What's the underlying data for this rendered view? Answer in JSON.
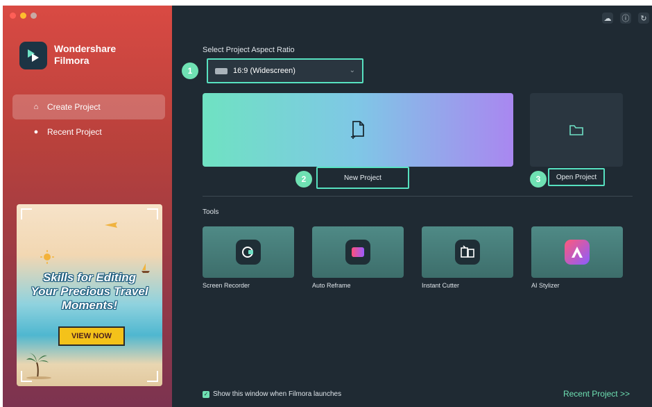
{
  "app": {
    "name": "Wondershare Filmora"
  },
  "sidebar": {
    "brand_line1": "Wondershare",
    "brand_line2": "Filmora",
    "items": [
      {
        "label": "Create Project",
        "icon": "home-icon",
        "active": true
      },
      {
        "label": "Recent Project",
        "icon": "clock-icon",
        "active": false
      }
    ],
    "banner": {
      "headline1": "Skills for Editing",
      "headline2": "Your Precious Travel",
      "headline3": "Moments!",
      "button_label": "VIEW NOW"
    }
  },
  "topbar": {
    "icons": [
      "cloud-icon",
      "info-icon",
      "refresh-icon"
    ]
  },
  "main": {
    "aspect_label": "Select Project Aspect Ratio",
    "aspect_value": "16:9 (Widescreen)",
    "steps": [
      "1",
      "2",
      "3"
    ],
    "new_project_label": "New Project",
    "open_project_label": "Open Project",
    "tools_label": "Tools",
    "tools": [
      {
        "label": "Screen Recorder",
        "icon": "screen-recorder-icon"
      },
      {
        "label": "Auto Reframe",
        "icon": "auto-reframe-icon"
      },
      {
        "label": "Instant Cutter",
        "icon": "instant-cutter-icon"
      },
      {
        "label": "AI Stylizer",
        "icon": "ai-stylizer-icon"
      }
    ],
    "show_window_label": "Show this window when Filmora launches",
    "show_window_checked": true,
    "recent_link": "Recent Project >>"
  },
  "colors": {
    "accent": "#57e1c0",
    "step_badge": "#6fe1b3",
    "main_bg": "#1f2a33"
  }
}
